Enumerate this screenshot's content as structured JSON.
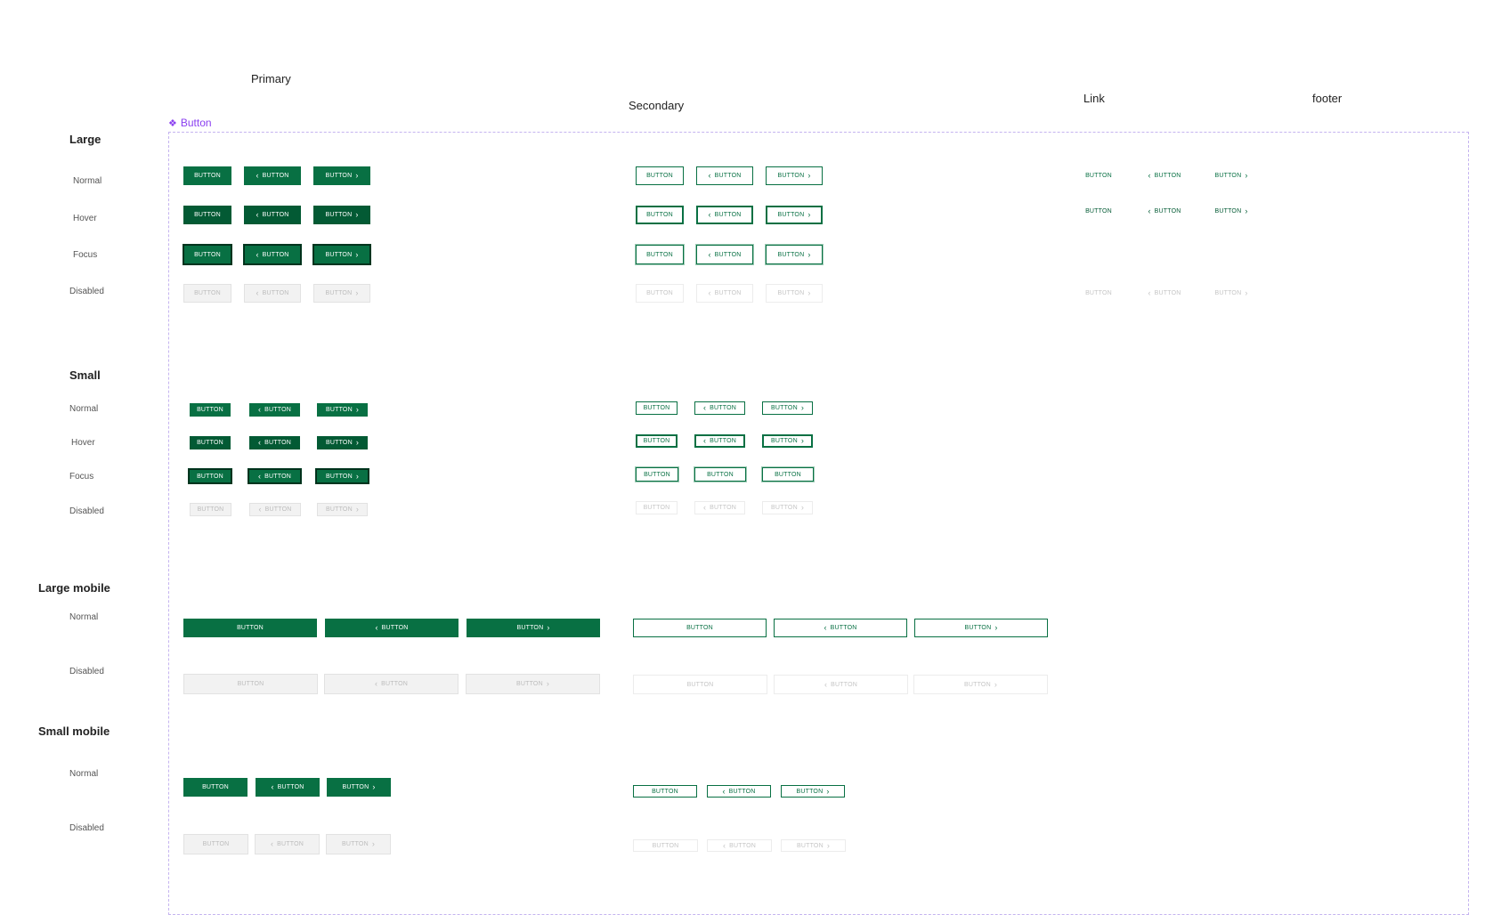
{
  "columns": {
    "primary": "Primary",
    "secondary": "Secondary",
    "link": "Link",
    "footer": "footer"
  },
  "frame": {
    "label": "Button",
    "icon": "component-icon"
  },
  "groups": {
    "large": "Large",
    "small": "Small",
    "large_mobile": "Large mobile",
    "small_mobile": "Small mobile"
  },
  "states": {
    "normal": "Normal",
    "hover": "Hover",
    "focus": "Focus",
    "disabled": "Disabled"
  },
  "button_label": "BUTTON",
  "icons": {
    "chevron_left": "chevron-left-icon",
    "chevron_right": "chevron-right-icon"
  },
  "colors": {
    "primary": "#087043",
    "primary_hover": "#035a34",
    "disabled_bg": "#f2f2f2",
    "disabled_text": "#bcbcbc",
    "frame_accent": "#8a3ff0"
  }
}
